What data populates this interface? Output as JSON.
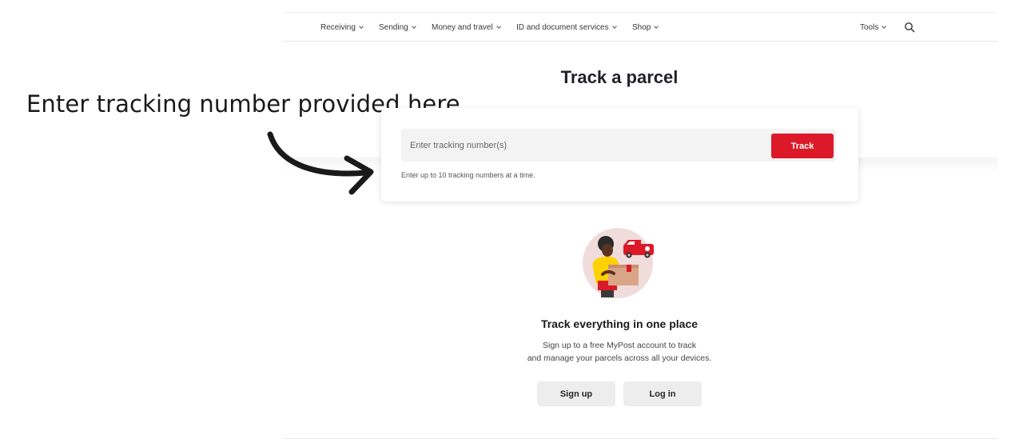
{
  "nav": {
    "items": [
      {
        "label": "Receiving"
      },
      {
        "label": "Sending"
      },
      {
        "label": "Money and travel"
      },
      {
        "label": "ID and document services"
      },
      {
        "label": "Shop"
      }
    ],
    "tools_label": "Tools",
    "search_icon": "search-icon"
  },
  "annotation": {
    "text": "Enter tracking number provided here",
    "arrow_icon": "curved-arrow-icon"
  },
  "page_title": "Track a parcel",
  "track": {
    "placeholder": "Enter tracking number(s)",
    "value": "",
    "button_label": "Track",
    "helper": "Enter up to 10 tracking numbers at a time."
  },
  "promo": {
    "illustration": "parcel-courier-illustration",
    "title": "Track everything in one place",
    "line1": "Sign up to a free MyPost account to track",
    "line2": "and manage your parcels across all your devices.",
    "signup_label": "Sign up",
    "login_label": "Log in"
  },
  "colors": {
    "accent_red": "#dc1928",
    "text_dark": "#212129",
    "field_grey": "#f3f3f3",
    "button_grey": "#ededed"
  }
}
